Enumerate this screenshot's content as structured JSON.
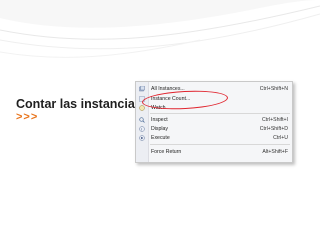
{
  "slide": {
    "text": "Contar las instancias",
    "chevrons": ">>>",
    "accent_color": "#e8731a",
    "circle_color": "#e0242e"
  },
  "menu": {
    "items": [
      {
        "label": "All Instances...",
        "shortcut": "Ctrl+Shift+N",
        "icon": "instances-icon"
      },
      {
        "label": "Instance Count...",
        "shortcut": "",
        "icon": "count-icon"
      },
      {
        "label": "Watch",
        "shortcut": "",
        "icon": "watch-icon"
      },
      {
        "label": "Inspect",
        "shortcut": "Ctrl+Shift+I",
        "icon": "inspect-icon"
      },
      {
        "label": "Display",
        "shortcut": "Ctrl+Shift+D",
        "icon": "display-icon"
      },
      {
        "label": "Execute",
        "shortcut": "Ctrl+U",
        "icon": "execute-icon"
      },
      {
        "label": "Force Return",
        "shortcut": "Alt+Shift+F",
        "icon": ""
      }
    ]
  }
}
